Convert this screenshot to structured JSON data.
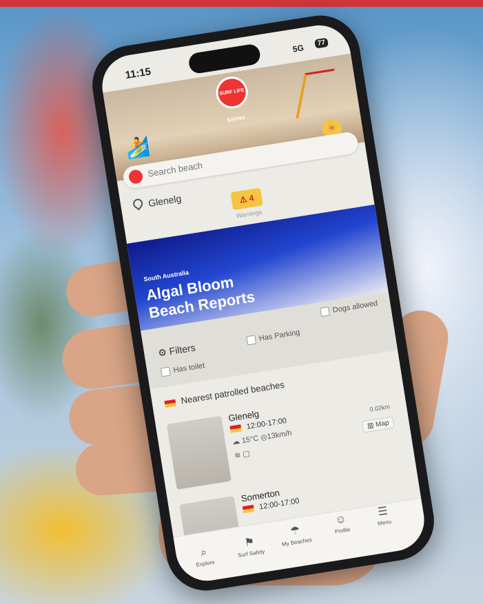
{
  "status": {
    "time": "11:15",
    "network": "5G",
    "battery": "77"
  },
  "header": {
    "logo_text": "SURF LIFE SAVING"
  },
  "search": {
    "placeholder": "Search beach"
  },
  "location": {
    "name": "Glenelg"
  },
  "warnings": {
    "count": "4",
    "label": "Warnings"
  },
  "banner": {
    "region": "South Australia",
    "title_line1": "Algal Bloom",
    "title_line2": "Beach Reports"
  },
  "filters": {
    "title": "Filters",
    "options": [
      "Dogs allowed",
      "Has Parking",
      "Has toilet"
    ]
  },
  "nearest": {
    "title": "Nearest patrolled beaches"
  },
  "beaches": [
    {
      "name": "Glenelg",
      "hours": "12:00-17:00",
      "temp": "15°C",
      "wind": "13km/h",
      "distance": "0.02km",
      "map_label": "Map"
    },
    {
      "name": "Somerton",
      "hours": "12:00-17:00"
    }
  ],
  "tabs": [
    "Explore",
    "Surf Safety",
    "My Beaches",
    "Profile",
    "Menu"
  ],
  "colors": {
    "accent_red": "#d2363a",
    "banner_blue": "#1b34b5",
    "warning_yellow": "#f5c542"
  }
}
